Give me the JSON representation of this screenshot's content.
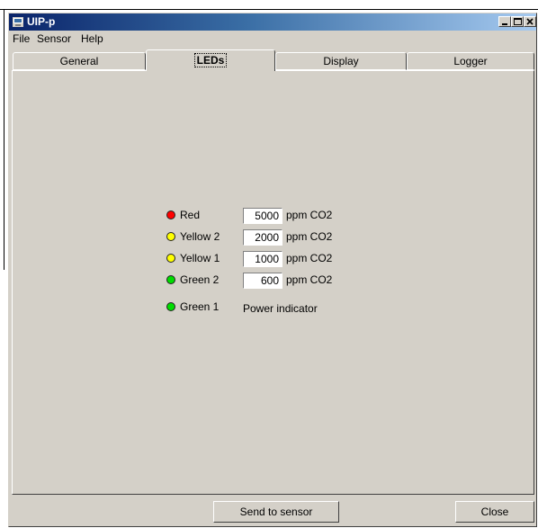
{
  "window": {
    "title": "UIP-p",
    "app_icon": "app-icon"
  },
  "menu": [
    "File",
    "Sensor",
    "Help"
  ],
  "tabs": [
    {
      "label": "General",
      "active": false
    },
    {
      "label": "LEDs",
      "active": true
    },
    {
      "label": "Display",
      "active": false
    },
    {
      "label": "Logger",
      "active": false
    }
  ],
  "leds": [
    {
      "label": "Red",
      "color": "#ff0000",
      "value": "5000",
      "unit": "ppm CO2"
    },
    {
      "label": "Yellow 2",
      "color": "#ffff00",
      "value": "2000",
      "unit": "ppm CO2"
    },
    {
      "label": "Yellow 1",
      "color": "#ffff00",
      "value": "1000",
      "unit": "ppm CO2"
    },
    {
      "label": "Green 2",
      "color": "#00dd00",
      "value": "600",
      "unit": "ppm CO2"
    },
    {
      "label": "Green 1",
      "color": "#00dd00",
      "note": "Power indicator"
    }
  ],
  "buttons": {
    "send": "Send to sensor",
    "close": "Close"
  }
}
